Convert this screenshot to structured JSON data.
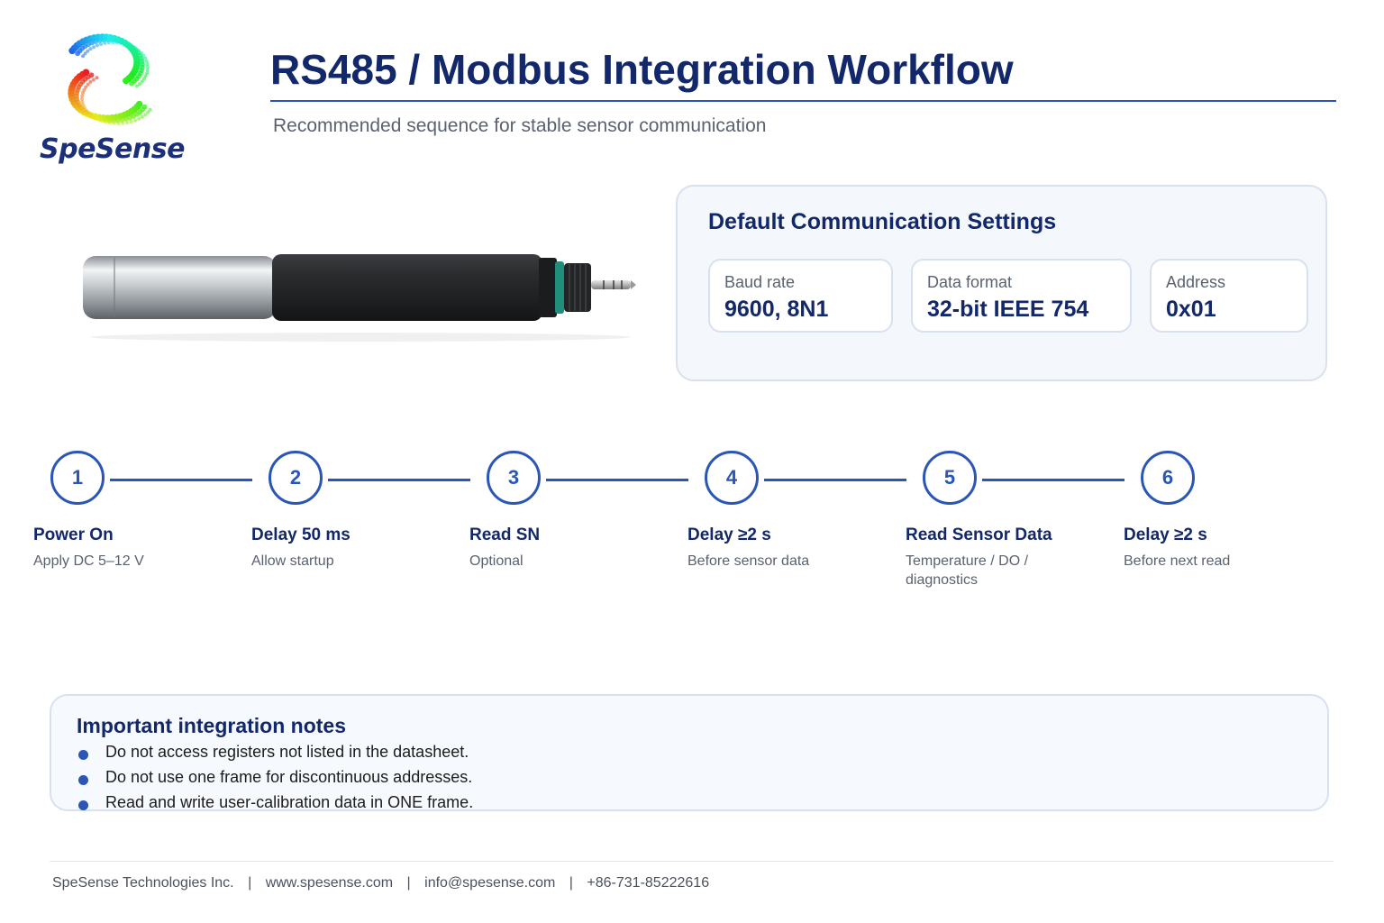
{
  "brand": {
    "name": "SpeSense"
  },
  "header": {
    "title": "RS485 / Modbus Integration Workflow",
    "subtitle": "Recommended sequence for stable sensor communication"
  },
  "settings": {
    "title": "Default Communication Settings",
    "items": [
      {
        "label": "Baud rate",
        "value": "9600, 8N1"
      },
      {
        "label": "Data format",
        "value": "32-bit IEEE 754"
      },
      {
        "label": "Address",
        "value": "0x01"
      }
    ]
  },
  "workflow": {
    "steps": [
      {
        "number": "1",
        "title": "Power On",
        "description": "Apply DC 5–12 V"
      },
      {
        "number": "2",
        "title": "Delay 50 ms",
        "description": "Allow startup"
      },
      {
        "number": "3",
        "title": "Read SN",
        "description": "Optional"
      },
      {
        "number": "4",
        "title": "Delay ≥2 s",
        "description": "Before sensor data"
      },
      {
        "number": "5",
        "title": "Read Sensor Data",
        "description": "Temperature / DO / diagnostics"
      },
      {
        "number": "6",
        "title": "Delay ≥2 s",
        "description": "Before next read"
      }
    ]
  },
  "notes": {
    "title": "Important integration notes",
    "items": [
      "Do not access registers not listed in the datasheet.",
      "Do not use one frame for discontinuous addresses.",
      "Read and write user-calibration data in ONE frame."
    ]
  },
  "footer": {
    "company": "SpeSense Technologies Inc.",
    "website": "www.spesense.com",
    "email": "info@spesense.com",
    "phone": "+86-731-85222616",
    "separator": "|"
  },
  "colors": {
    "accent": "#2a56b8",
    "title": "#13286b",
    "muted": "#5a6270",
    "card_border": "#d8e1ee",
    "card_bg": "#f4f7fb"
  },
  "icons": [
    "spesense-logo-icon",
    "sensor-probe-image"
  ]
}
